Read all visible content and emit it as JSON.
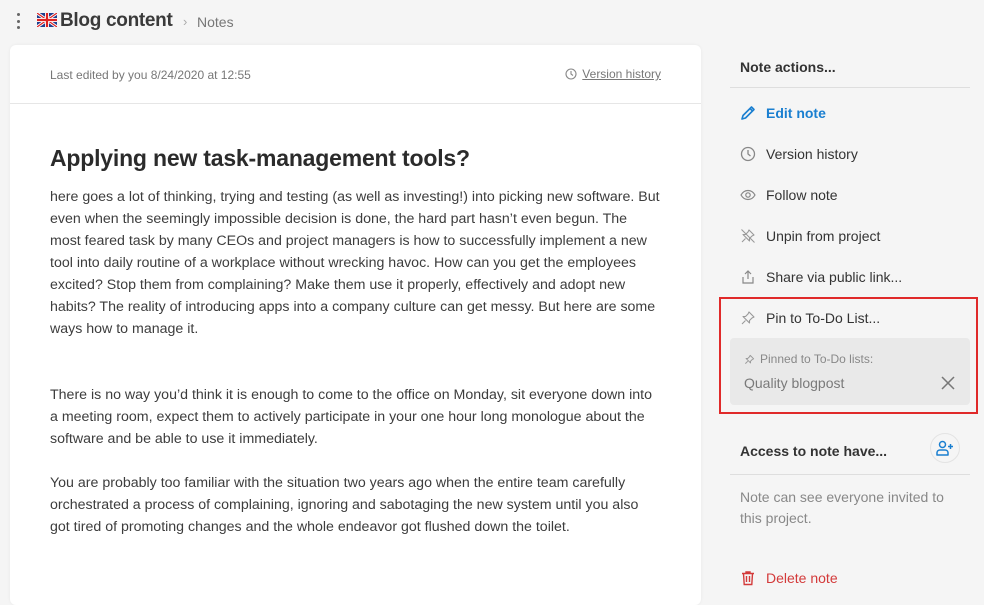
{
  "header": {
    "flag_icon": "uk-flag-icon",
    "title": "Blog content",
    "separator": "›",
    "breadcrumb": "Notes"
  },
  "note": {
    "last_edited": "Last edited by you 8/24/2020 at 12:55",
    "version_history_link": "Version history",
    "heading": "Applying new task-management tools?",
    "paragraphs": [
      "here goes a lot of thinking, trying and testing (as well as investing!) into picking new software. But even when the seemingly impossible decision is done, the hard part hasn’t even begun. The most feared task by many CEOs and project managers is how to successfully implement a new tool into daily routine of a workplace without wrecking havoc. How can you get the employees excited? Stop them from complaining? Make them use it properly, effectively and adopt new habits? The reality of introducing apps into a company culture can get messy. But here are some ways how to manage it.",
      "There is no way you’d think it is enough to come to the office on Monday, sit everyone down into a meeting room, expect them to actively participate in your one hour long monologue about the software and be able to use it immediately.",
      "You are probably too familiar with the situation two years ago when the entire team carefully orchestrated a process of complaining, ignoring and sabotaging the new system until you also got tired of promoting changes and the whole endeavor got flushed down the toilet."
    ]
  },
  "sidebar": {
    "actions_title": "Note actions...",
    "actions": [
      {
        "label": "Edit note",
        "icon": "pencil-icon"
      },
      {
        "label": "Version history",
        "icon": "clock-icon"
      },
      {
        "label": "Follow note",
        "icon": "eye-icon"
      },
      {
        "label": "Unpin from project",
        "icon": "unpin-icon"
      },
      {
        "label": "Share via public link...",
        "icon": "share-icon"
      },
      {
        "label": "Pin to To-Do List...",
        "icon": "pin-icon"
      }
    ],
    "pinned": {
      "label": "Pinned to To-Do lists:",
      "value": "Quality blogpost"
    },
    "access_title": "Access to note have...",
    "access_desc": "Note can see everyone invited to this project.",
    "delete_label": "Delete note"
  },
  "colors": {
    "accent": "#1a7fd0",
    "danger": "#d33a3a",
    "highlight": "#e02a2a"
  }
}
